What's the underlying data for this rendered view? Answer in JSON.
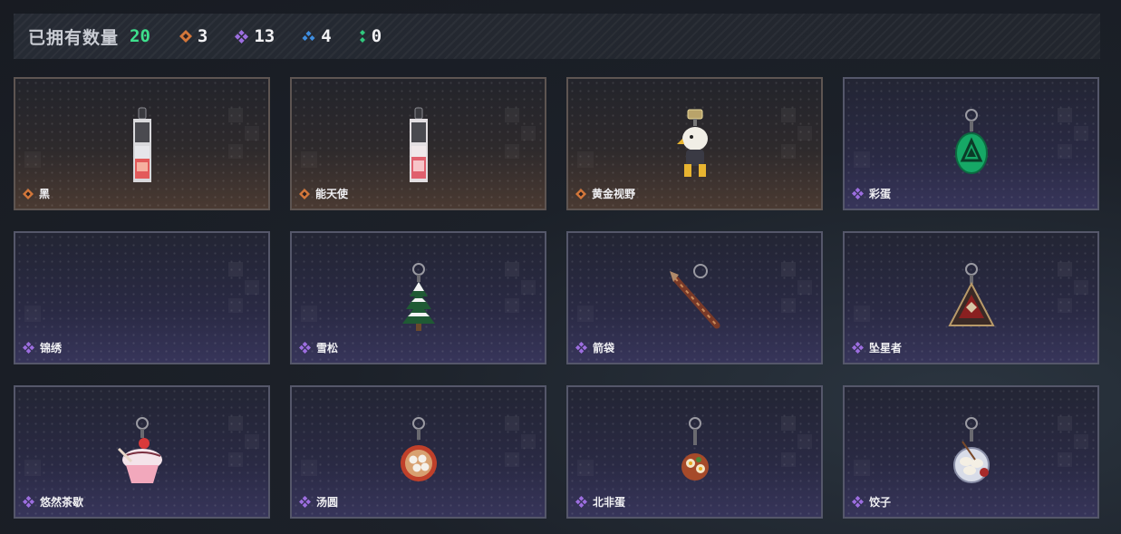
{
  "header": {
    "owned_label": "已拥有数量",
    "owned_count": "20",
    "rarity_counts": [
      {
        "icon": "orange-diamond-icon",
        "color": "#d4773a",
        "count": "3"
      },
      {
        "icon": "purple-diamond-icon",
        "color": "#9d6ee0",
        "count": "13"
      },
      {
        "icon": "blue-diamond-icon",
        "color": "#3f8ee0",
        "count": "4"
      },
      {
        "icon": "green-diamond-icon",
        "color": "#31c97e",
        "count": "0"
      }
    ]
  },
  "colors": {
    "owned_count": "#3ee08d",
    "orange_rarity": "#d4773a",
    "purple_rarity": "#9d6ee0"
  },
  "items": [
    {
      "name": "黑",
      "rarity": "orange",
      "icon": "black-keychain-icon"
    },
    {
      "name": "能天使",
      "rarity": "orange",
      "icon": "exusiai-keychain-icon"
    },
    {
      "name": "黄金视野",
      "rarity": "orange",
      "icon": "golden-vision-figure-icon"
    },
    {
      "name": "彩蛋",
      "rarity": "purple",
      "icon": "easter-egg-charm-icon"
    },
    {
      "name": "锦绣",
      "rarity": "purple",
      "icon": "empty-slot"
    },
    {
      "name": "雪松",
      "rarity": "purple",
      "icon": "snow-pine-charm-icon"
    },
    {
      "name": "箭袋",
      "rarity": "purple",
      "icon": "quiver-charm-icon"
    },
    {
      "name": "坠星者",
      "rarity": "purple",
      "icon": "star-faller-charm-icon"
    },
    {
      "name": "悠然茶歇",
      "rarity": "purple",
      "icon": "cupcake-charm-icon"
    },
    {
      "name": "汤圆",
      "rarity": "purple",
      "icon": "tangyuan-bowl-charm-icon"
    },
    {
      "name": "北非蛋",
      "rarity": "purple",
      "icon": "shakshuka-charm-icon"
    },
    {
      "name": "饺子",
      "rarity": "purple",
      "icon": "dumpling-plate-charm-icon"
    }
  ]
}
